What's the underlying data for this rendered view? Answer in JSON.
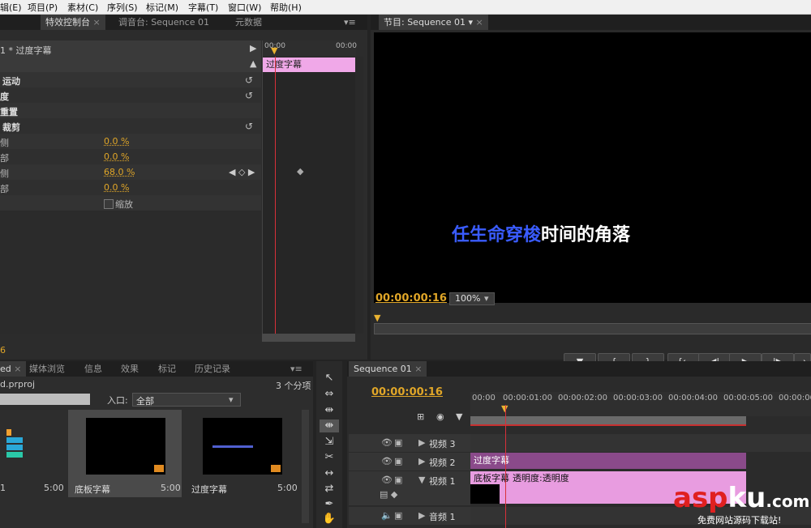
{
  "menu": [
    "辑(E)",
    "项目(P)",
    "素材(C)",
    "序列(S)",
    "标记(M)",
    "字幕(T)",
    "窗口(W)",
    "帮助(H)"
  ],
  "effect_controls": {
    "tab_left_frag": "",
    "tabs": [
      "特效控制台",
      "调音台: Sequence 01",
      "元数据"
    ],
    "clip_title": "1 * 过度字幕",
    "clip_bar_label": "过度字幕",
    "ruler_start": "00:00",
    "ruler_end": "00:00",
    "props": [
      {
        "label": "运动"
      },
      {
        "label": "度"
      },
      {
        "label": "重置"
      },
      {
        "label": "裁剪"
      },
      {
        "label": "侧",
        "value": "0.0 %"
      },
      {
        "label": "部",
        "value": "0.0 %"
      },
      {
        "label": "侧",
        "value": "68.0 %"
      },
      {
        "label": "部",
        "value": "0.0 %"
      }
    ],
    "zoom_checkbox_label": "缩放",
    "bottom_timecode": "6"
  },
  "program": {
    "tab": "节目: Sequence 01",
    "caption_highlight": "任生命穿梭",
    "caption_rest": "时间的角落",
    "timecode": "00:00:00:16",
    "zoom": "100%",
    "transport": [
      "▼",
      "{",
      "}",
      "{←",
      "◀|",
      "▶",
      "|▶",
      "→"
    ]
  },
  "project": {
    "tabs": [
      "ed",
      "媒体浏览",
      "信息",
      "效果",
      "标记",
      "历史记录"
    ],
    "file": "d.prproj",
    "count": "3 个分项",
    "entry_label": "入口:",
    "entry_value": "全部",
    "items": [
      {
        "name": "1",
        "dur": "5:00"
      },
      {
        "name": "底板字幕",
        "dur": "5:00"
      },
      {
        "name": "过度字幕",
        "dur": "5:00"
      }
    ]
  },
  "timeline": {
    "tab": "Sequence 01",
    "timecode": "00:00:00:16",
    "ruler": [
      "00:00",
      "00:00:01:00",
      "00:00:02:00",
      "00:00:03:00",
      "00:00:04:00",
      "00:00:05:00",
      "00:00:06"
    ],
    "tracks": [
      {
        "name": "视频 3"
      },
      {
        "name": "视频 2",
        "clip": "过度字幕"
      },
      {
        "name": "视频 1",
        "clip": "底板字幕",
        "clip_fx": "透明度:透明度"
      },
      {
        "name": "音频 1"
      }
    ]
  },
  "watermark": {
    "brand_a": "asp",
    "brand_b": "ku",
    ".com": ".com",
    "tagline": "免费网站源码下载站!"
  }
}
